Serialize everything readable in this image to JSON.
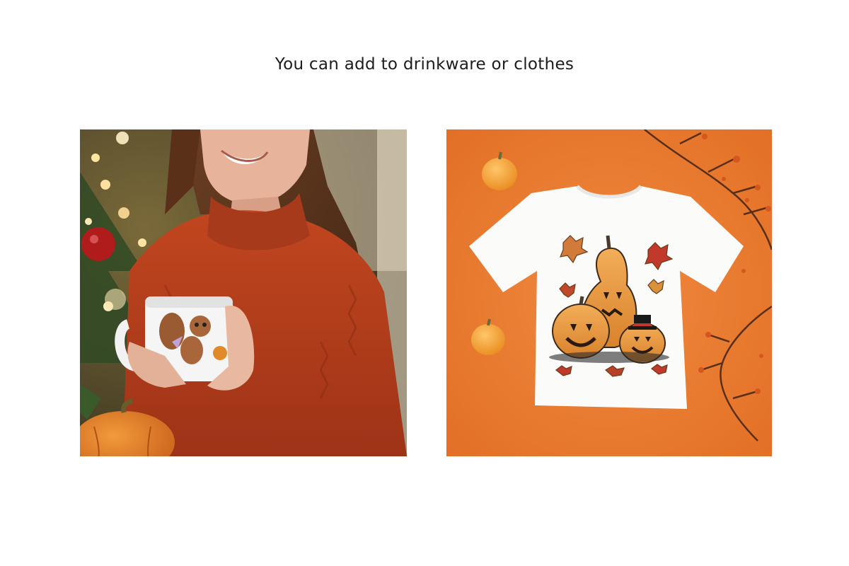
{
  "headline": "You can add to drinkware or clothes",
  "images": [
    {
      "subject": "woman in red knit sweater holding a white mug with a fairy squirrel print",
      "icon": "mug-photo"
    },
    {
      "subject": "white t-shirt with jack-o-lantern pumpkins and autumn leaves on orange background",
      "icon": "tshirt-photo"
    }
  ],
  "colors": {
    "sweater": "#b8401f",
    "shirt_bg": "#e8792f",
    "pumpkin": "#e08a2a"
  }
}
